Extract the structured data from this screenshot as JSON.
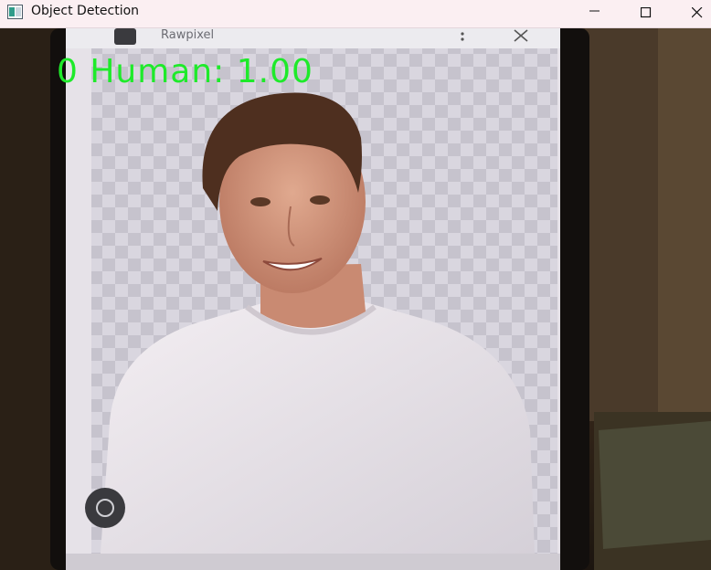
{
  "window": {
    "title": "Object Detection",
    "controls": {
      "minimize": "minimize-icon",
      "maximize": "maximize-icon",
      "close": "close-icon"
    }
  },
  "detection": {
    "label": "0 Human: 1.00",
    "color": "#1eea2a"
  },
  "phone_screen": {
    "app_name": "Rawpixel"
  }
}
